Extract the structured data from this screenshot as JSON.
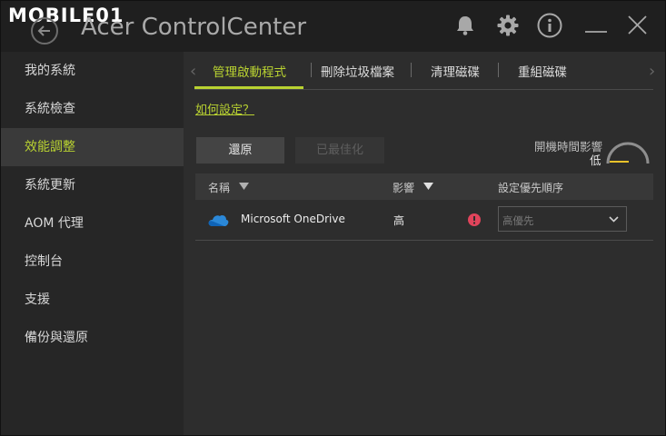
{
  "watermark": "MOBILE01",
  "app": {
    "title": "Acer ControlCenter"
  },
  "sidebar": {
    "items": [
      {
        "label": "我的系統"
      },
      {
        "label": "系統檢查"
      },
      {
        "label": "效能調整"
      },
      {
        "label": "系統更新"
      },
      {
        "label": "AOM 代理"
      },
      {
        "label": "控制台"
      },
      {
        "label": "支援"
      },
      {
        "label": "備份與還原"
      }
    ],
    "active_index": 2
  },
  "tabs": [
    {
      "label": "管理啟動程式"
    },
    {
      "label": "刪除垃圾檔案"
    },
    {
      "label": "清理磁碟"
    },
    {
      "label": "重組磁碟"
    }
  ],
  "help_link": "如何設定？",
  "buttons": {
    "restore": "還原",
    "optimized": "已最佳化"
  },
  "boot_impact": {
    "label": "開機時間影響",
    "value": "低"
  },
  "table": {
    "headers": {
      "name": "名稱",
      "impact": "影響",
      "priority": "設定優先順序"
    },
    "rows": [
      {
        "name": "Microsoft OneDrive",
        "impact": "高",
        "priority": "高優先"
      }
    ]
  },
  "colors": {
    "accent": "#b9d231",
    "warning": "#e0445b",
    "gauge_needle": "#e8c22a"
  },
  "icons": [
    "back-arrow-icon",
    "bell-icon",
    "gear-icon",
    "info-icon",
    "minimize-icon",
    "close-icon",
    "onedrive-icon",
    "warning-icon",
    "chevron-down-icon"
  ]
}
